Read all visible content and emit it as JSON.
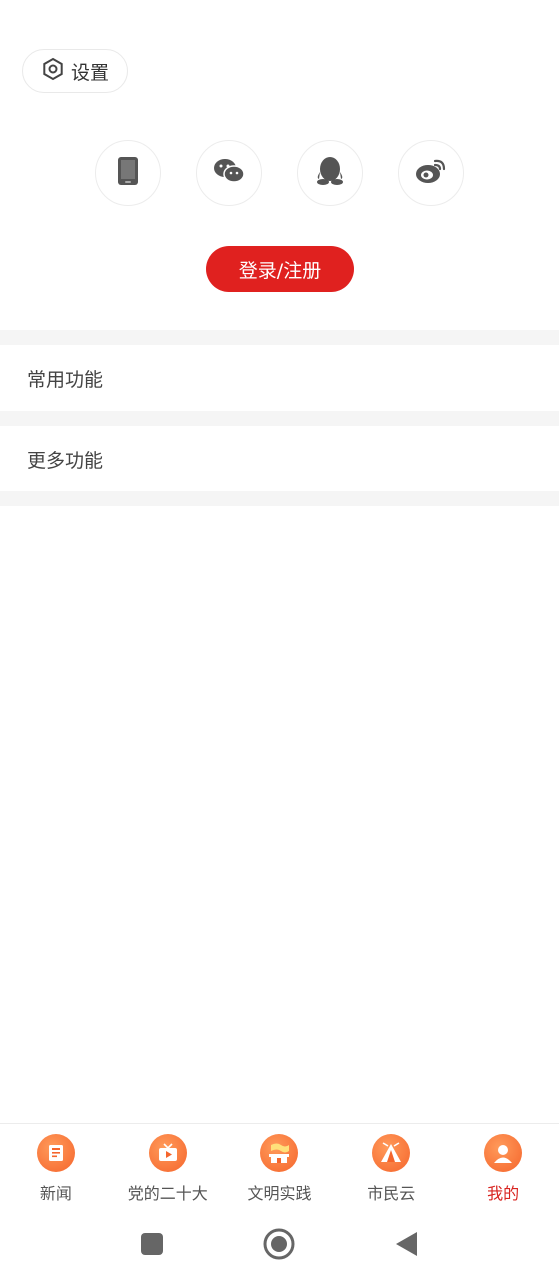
{
  "settings": {
    "label": "设置",
    "icon": "hexagon-gear-icon"
  },
  "login_options": [
    {
      "name": "phone",
      "icon": "phone-icon"
    },
    {
      "name": "wechat",
      "icon": "wechat-icon"
    },
    {
      "name": "qq",
      "icon": "qq-icon"
    },
    {
      "name": "weibo",
      "icon": "weibo-icon"
    }
  ],
  "login_button": {
    "label": "登录/注册"
  },
  "sections": [
    {
      "title": "常用功能"
    },
    {
      "title": "更多功能"
    }
  ],
  "tabs": [
    {
      "label": "新闻",
      "icon": "news-icon",
      "active": false
    },
    {
      "label": "党的二十大",
      "icon": "tv-play-icon",
      "active": false
    },
    {
      "label": "文明实践",
      "icon": "gate-flag-icon",
      "active": false
    },
    {
      "label": "市民云",
      "icon": "tent-icon",
      "active": false
    },
    {
      "label": "我的",
      "icon": "user-icon",
      "active": true
    }
  ],
  "colors": {
    "accent": "#e0211f",
    "active_tab": "#d8231f",
    "tab_icon": "#f5652c",
    "divider": "#f5f5f5"
  },
  "system_nav": [
    "recent-apps-icon",
    "home-icon",
    "back-icon"
  ]
}
